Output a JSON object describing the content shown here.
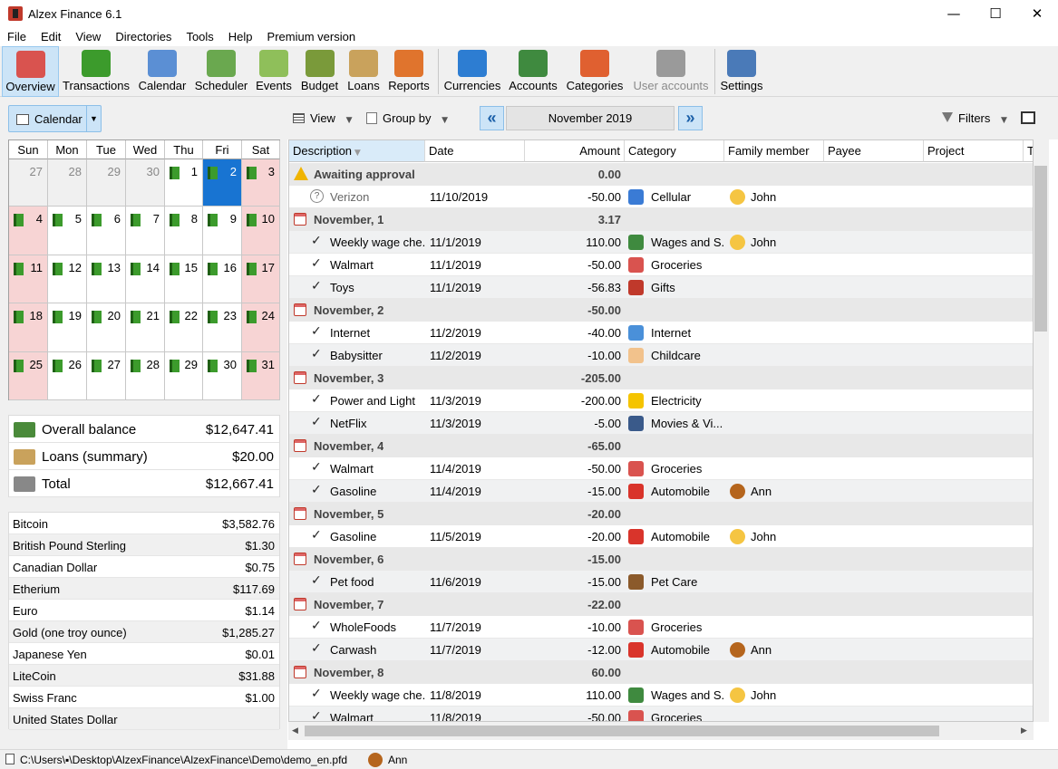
{
  "window": {
    "title": "Alzex Finance 6.1"
  },
  "menu": [
    "File",
    "Edit",
    "View",
    "Directories",
    "Tools",
    "Help",
    "Premium version"
  ],
  "toolbar": [
    {
      "label": "Overview",
      "icon": "calendar-icon",
      "color": "#d9534f",
      "active": true
    },
    {
      "label": "Transactions",
      "icon": "book-icon",
      "color": "#3c9b2c"
    },
    {
      "label": "Calendar",
      "icon": "calendar-grid-icon",
      "color": "#5b8fd4"
    },
    {
      "label": "Scheduler",
      "icon": "clock-icon",
      "color": "#6aa84f"
    },
    {
      "label": "Events",
      "icon": "notes-lock-icon",
      "color": "#8fbf5a"
    },
    {
      "label": "Budget",
      "icon": "money-bag-lock-icon",
      "color": "#7a9a3a"
    },
    {
      "label": "Loans",
      "icon": "hand-money-lock-icon",
      "color": "#c9a25c"
    },
    {
      "label": "Reports",
      "icon": "pie-chart-lock-icon",
      "color": "#e0742d"
    },
    {
      "label": "Currencies",
      "icon": "currency-icon",
      "color": "#2d7dd2"
    },
    {
      "label": "Accounts",
      "icon": "cash-stack-icon",
      "color": "#3f8a3f"
    },
    {
      "label": "Categories",
      "icon": "category-tree-icon",
      "color": "#e06030"
    },
    {
      "label": "User accounts",
      "icon": "users-icon",
      "color": "#9a9a9a",
      "disabled": true
    },
    {
      "label": "Settings",
      "icon": "settings-icon",
      "color": "#4a7ab8"
    }
  ],
  "calendar_button": {
    "label": "Calendar"
  },
  "calendar": {
    "weekdays": [
      "Sun",
      "Mon",
      "Tue",
      "Wed",
      "Thu",
      "Fri",
      "Sat"
    ],
    "days": [
      "27",
      "28",
      "29",
      "30",
      "1",
      "2",
      "3",
      "4",
      "5",
      "6",
      "7",
      "8",
      "9",
      "10",
      "11",
      "12",
      "13",
      "14",
      "15",
      "16",
      "17",
      "18",
      "19",
      "20",
      "21",
      "22",
      "23",
      "24",
      "25",
      "26",
      "27",
      "28",
      "29",
      "30",
      "31"
    ],
    "selected_day": "2"
  },
  "balances": [
    {
      "label": "Overall balance",
      "value": "$12,647.41",
      "icon": "cash-register-icon"
    },
    {
      "label": "Loans (summary)",
      "value": "$20.00",
      "icon": "hand-money-icon"
    },
    {
      "label": "Total",
      "value": "$12,667.41",
      "icon": "scales-icon"
    }
  ],
  "currencies": [
    {
      "name": "Bitcoin",
      "value": "$3,582.76"
    },
    {
      "name": "British Pound Sterling",
      "value": "$1.30"
    },
    {
      "name": "Canadian Dollar",
      "value": "$0.75"
    },
    {
      "name": "Etherium",
      "value": "$117.69"
    },
    {
      "name": "Euro",
      "value": "$1.14"
    },
    {
      "name": "Gold (one troy ounce)",
      "value": "$1,285.27"
    },
    {
      "name": "Japanese Yen",
      "value": "$0.01"
    },
    {
      "name": "LiteCoin",
      "value": "$31.88"
    },
    {
      "name": "Swiss Franc",
      "value": "$1.00"
    },
    {
      "name": "United States Dollar",
      "value": ""
    }
  ],
  "main_toolbar": {
    "view": "View",
    "group_by": "Group by",
    "month": "November 2019",
    "filters": "Filters"
  },
  "columns": [
    "Description",
    "Date",
    "Amount",
    "Category",
    "Family member",
    "Payee",
    "Project",
    "Tag"
  ],
  "rows": [
    {
      "type": "group",
      "label": "Awaiting approval",
      "amount": "0.00",
      "warn": true
    },
    {
      "type": "tx",
      "pending": true,
      "desc": "Verizon",
      "date": "11/10/2019",
      "amount": "-50.00",
      "cat": "Cellular",
      "cat_icon": "phone-icon",
      "member": "John"
    },
    {
      "type": "group",
      "label": "November, 1",
      "amount": "3.17"
    },
    {
      "type": "tx",
      "desc": "Weekly wage che...",
      "date": "11/1/2019",
      "amount": "110.00",
      "cat": "Wages and S...",
      "cat_icon": "money-icon",
      "member": "John"
    },
    {
      "type": "tx",
      "desc": "Walmart",
      "date": "11/1/2019",
      "amount": "-50.00",
      "cat": "Groceries",
      "cat_icon": "basket-icon",
      "member": ""
    },
    {
      "type": "tx",
      "desc": "Toys",
      "date": "11/1/2019",
      "amount": "-56.83",
      "cat": "Gifts",
      "cat_icon": "gift-icon",
      "member": ""
    },
    {
      "type": "group",
      "label": "November, 2",
      "amount": "-50.00"
    },
    {
      "type": "tx",
      "desc": "Internet",
      "date": "11/2/2019",
      "amount": "-40.00",
      "cat": "Internet",
      "cat_icon": "globe-icon",
      "member": ""
    },
    {
      "type": "tx",
      "desc": "Babysitter",
      "date": "11/2/2019",
      "amount": "-10.00",
      "cat": "Childcare",
      "cat_icon": "baby-icon",
      "member": ""
    },
    {
      "type": "group",
      "label": "November, 3",
      "amount": "-205.00"
    },
    {
      "type": "tx",
      "desc": "Power and Light",
      "date": "11/3/2019",
      "amount": "-200.00",
      "cat": "Electricity",
      "cat_icon": "bulb-icon",
      "member": ""
    },
    {
      "type": "tx",
      "desc": "NetFlix",
      "date": "11/3/2019",
      "amount": "-5.00",
      "cat": "Movies & Vi...",
      "cat_icon": "film-reel-icon",
      "member": ""
    },
    {
      "type": "group",
      "label": "November, 4",
      "amount": "-65.00"
    },
    {
      "type": "tx",
      "desc": "Walmart",
      "date": "11/4/2019",
      "amount": "-50.00",
      "cat": "Groceries",
      "cat_icon": "basket-icon",
      "member": ""
    },
    {
      "type": "tx",
      "desc": "Gasoline",
      "date": "11/4/2019",
      "amount": "-15.00",
      "cat": "Automobile",
      "cat_icon": "car-icon",
      "member": "Ann"
    },
    {
      "type": "group",
      "label": "November, 5",
      "amount": "-20.00"
    },
    {
      "type": "tx",
      "desc": "Gasoline",
      "date": "11/5/2019",
      "amount": "-20.00",
      "cat": "Automobile",
      "cat_icon": "car-icon",
      "member": "John"
    },
    {
      "type": "group",
      "label": "November, 6",
      "amount": "-15.00"
    },
    {
      "type": "tx",
      "desc": "Pet food",
      "date": "11/6/2019",
      "amount": "-15.00",
      "cat": "Pet Care",
      "cat_icon": "dog-icon",
      "member": ""
    },
    {
      "type": "group",
      "label": "November, 7",
      "amount": "-22.00"
    },
    {
      "type": "tx",
      "desc": "WholeFoods",
      "date": "11/7/2019",
      "amount": "-10.00",
      "cat": "Groceries",
      "cat_icon": "basket-icon",
      "member": ""
    },
    {
      "type": "tx",
      "desc": "Carwash",
      "date": "11/7/2019",
      "amount": "-12.00",
      "cat": "Automobile",
      "cat_icon": "car-icon",
      "member": "Ann"
    },
    {
      "type": "group",
      "label": "November, 8",
      "amount": "60.00"
    },
    {
      "type": "tx",
      "desc": "Weekly wage che...",
      "date": "11/8/2019",
      "amount": "110.00",
      "cat": "Wages and S...",
      "cat_icon": "money-icon",
      "member": "John"
    },
    {
      "type": "tx",
      "desc": "Walmart",
      "date": "11/8/2019",
      "amount": "-50.00",
      "cat": "Groceries",
      "cat_icon": "basket-icon",
      "member": ""
    }
  ],
  "status": {
    "path": "C:\\Users\\▪\\Desktop\\AlzexFinance\\AlzexFinance\\Demo\\demo_en.pfd",
    "user": "Ann"
  },
  "colors": {
    "accent": "#1874d2",
    "weekend": "#f7d4d4",
    "selection": "#cce4f7"
  }
}
